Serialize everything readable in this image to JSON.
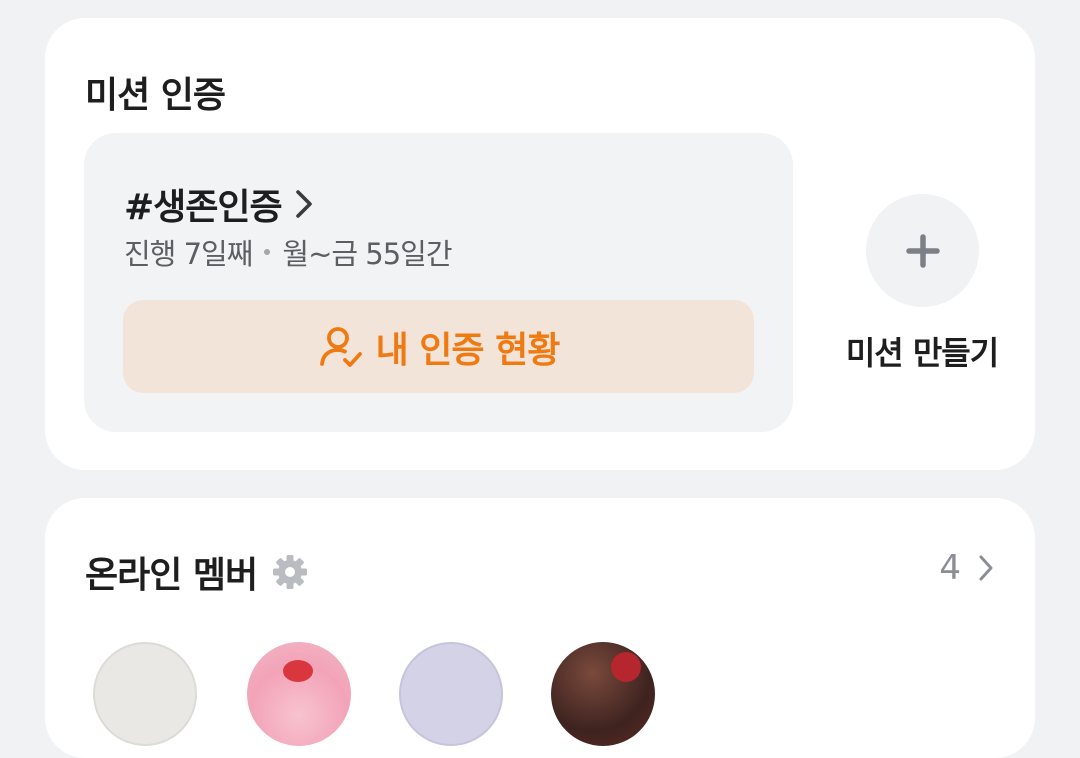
{
  "mission_section": {
    "title": "미션 인증",
    "mission": {
      "name": "#생존인증",
      "progress_text": "진행 7일째",
      "schedule_text": "월~금 55일간"
    },
    "status_button_label": "내 인증 현황",
    "create_mission_label": "미션 만들기",
    "icons": {
      "chevron": "chevron-right-icon",
      "status": "user-check-icon",
      "create": "plus-icon"
    }
  },
  "members_section": {
    "title": "온라인 멤버",
    "count": "4",
    "icons": {
      "settings": "gear-icon",
      "more": "chevron-right-icon"
    },
    "avatar_count": 4
  },
  "colors": {
    "accent_orange": "#f07a12",
    "status_button_bg": "#f3e4da",
    "page_bg": "#f1f2f4",
    "card_bg": "#ffffff",
    "mission_box_bg": "#f2f3f5",
    "muted_text": "#8b8e94",
    "plus_icon": "#7b7f87"
  }
}
